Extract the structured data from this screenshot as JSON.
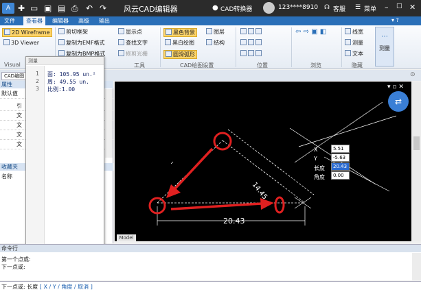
{
  "titlebar": {
    "title": "风云CAD编辑器",
    "converter": "CAD转换器",
    "user": "123****8910",
    "service": "客服",
    "menu": "菜单"
  },
  "menubar": {
    "file": "文件",
    "tabs": [
      "查看器",
      "编辑器",
      "高级",
      "输出"
    ]
  },
  "ribbon": {
    "visual": {
      "items": [
        "2D Wireframe",
        "3D Viewer"
      ],
      "group": "Visual"
    },
    "tools": {
      "items": [
        "剪切框架",
        "复制为EMF格式",
        "复制为BMP格式",
        "显示点",
        "查找文字",
        "修剪光栅"
      ],
      "group": "工具"
    },
    "settings": {
      "items": [
        "黑色背景",
        "黑白绘图",
        "圆滑弧形",
        "图层",
        "结构"
      ],
      "group": "CAD绘图设置"
    },
    "position": {
      "group": "位置"
    },
    "browse": {
      "group": "浏览"
    },
    "hide": {
      "items": [
        "线宽",
        "测量",
        "文本"
      ],
      "group": "隐藏"
    },
    "measure": {
      "label": "测量"
    }
  },
  "tabstrip": {
    "doc": "CAD编图"
  },
  "leftpanel": {
    "props_header": "属性",
    "default_label": "默认值",
    "rows": [
      "引",
      "文",
      "文",
      "文",
      "文"
    ],
    "bookmarks_header": "收藏夹",
    "name_label": "名称"
  },
  "popup": {
    "title": "测量",
    "lines": [
      {
        "n": "1",
        "text": "面: 105.95 un.²"
      },
      {
        "n": "2",
        "text": "周: 49.55 un."
      },
      {
        "n": "3",
        "text": "比例:1.00"
      }
    ]
  },
  "canvas": {
    "model_tab": "Model",
    "dim_bottom": "20.43",
    "dim_slant": "14.45",
    "coord": {
      "x_label": "X",
      "x_value": "5.51",
      "y_label": "Y",
      "y_value": "-5.63",
      "len_label": "长度",
      "len_value": "20.43",
      "angle_label": "角度",
      "angle_value": "0.00"
    }
  },
  "command": {
    "header": "命令行",
    "lines": [
      "第一个点或:",
      "下一点或:"
    ],
    "prompt": "下一点或: 长度",
    "options": "[ X / Y / 角度 / 取消 ]"
  },
  "colors": {
    "titlebar": "#2b2b2b",
    "accent": "#2a6fb8",
    "highlight": "#ffd56a",
    "annotation": "#e02020"
  }
}
